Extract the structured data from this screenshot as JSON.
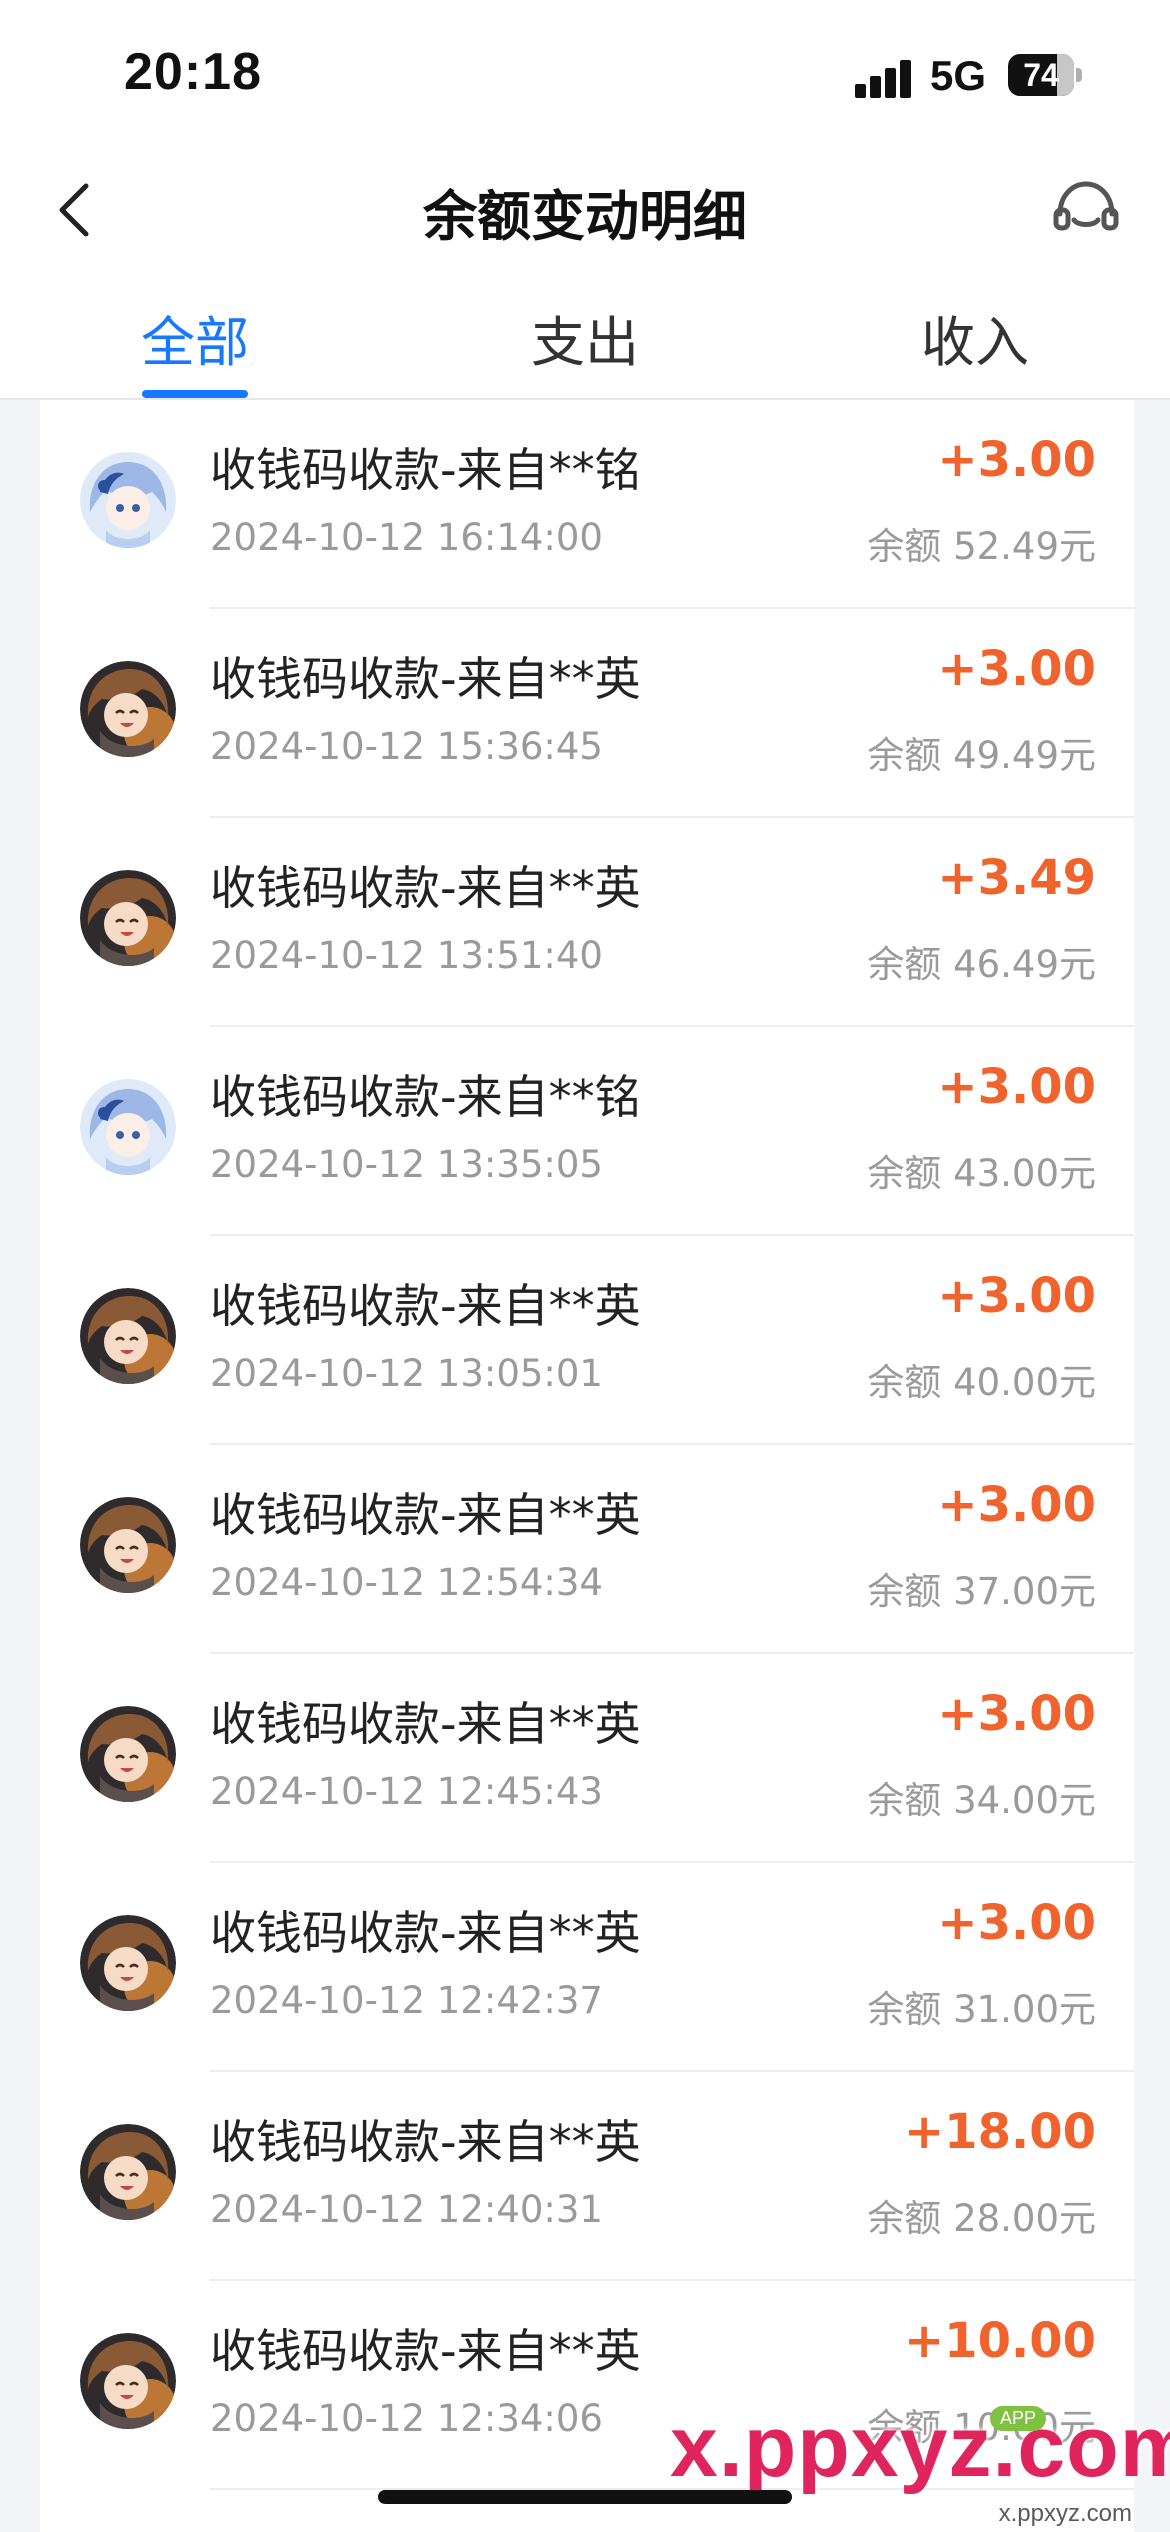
{
  "status_bar": {
    "time": "20:18",
    "network": "5G",
    "battery_level": "74",
    "battery_fraction": 0.74,
    "signal_icon": "signal-bars-icon"
  },
  "header": {
    "title": "余额变动明细",
    "back_icon": "chevron-left-icon",
    "support_icon": "headset-icon"
  },
  "tabs": [
    {
      "label": "全部",
      "active": true
    },
    {
      "label": "支出",
      "active": false
    },
    {
      "label": "收入",
      "active": false
    }
  ],
  "colors": {
    "accent": "#1677ff",
    "amount_positive": "#f0632c",
    "secondary_text": "#9a9a9a",
    "background": "#f3f4f8"
  },
  "transactions": [
    {
      "title": "收钱码收款-来自**铭",
      "time": "2024-10-12 16:14:00",
      "amount": "+3.00",
      "balance": "余额 52.49元",
      "avatar": "anime-blue-hair-avatar"
    },
    {
      "title": "收钱码收款-来自**英",
      "time": "2024-10-12 15:36:45",
      "amount": "+3.00",
      "balance": "余额 49.49元",
      "avatar": "anime-brown-hair-avatar"
    },
    {
      "title": "收钱码收款-来自**英",
      "time": "2024-10-12 13:51:40",
      "amount": "+3.49",
      "balance": "余额 46.49元",
      "avatar": "anime-brown-hair-avatar"
    },
    {
      "title": "收钱码收款-来自**铭",
      "time": "2024-10-12 13:35:05",
      "amount": "+3.00",
      "balance": "余额 43.00元",
      "avatar": "anime-blue-hair-avatar"
    },
    {
      "title": "收钱码收款-来自**英",
      "time": "2024-10-12 13:05:01",
      "amount": "+3.00",
      "balance": "余额 40.00元",
      "avatar": "anime-brown-hair-avatar"
    },
    {
      "title": "收钱码收款-来自**英",
      "time": "2024-10-12 12:54:34",
      "amount": "+3.00",
      "balance": "余额 37.00元",
      "avatar": "anime-brown-hair-avatar"
    },
    {
      "title": "收钱码收款-来自**英",
      "time": "2024-10-12 12:45:43",
      "amount": "+3.00",
      "balance": "余额 34.00元",
      "avatar": "anime-brown-hair-avatar"
    },
    {
      "title": "收钱码收款-来自**英",
      "time": "2024-10-12 12:42:37",
      "amount": "+3.00",
      "balance": "余额 31.00元",
      "avatar": "anime-brown-hair-avatar"
    },
    {
      "title": "收钱码收款-来自**英",
      "time": "2024-10-12 12:40:31",
      "amount": "+18.00",
      "balance": "余额 28.00元",
      "avatar": "anime-brown-hair-avatar"
    },
    {
      "title": "收钱码收款-来自**英",
      "time": "2024-10-12 12:34:06",
      "amount": "+10.00",
      "balance": "余额 10.00元",
      "avatar": "anime-brown-hair-avatar"
    }
  ],
  "watermark": {
    "main": "x.ppxyz.com",
    "sub": "x.ppxyz.com",
    "tag": "APP"
  }
}
